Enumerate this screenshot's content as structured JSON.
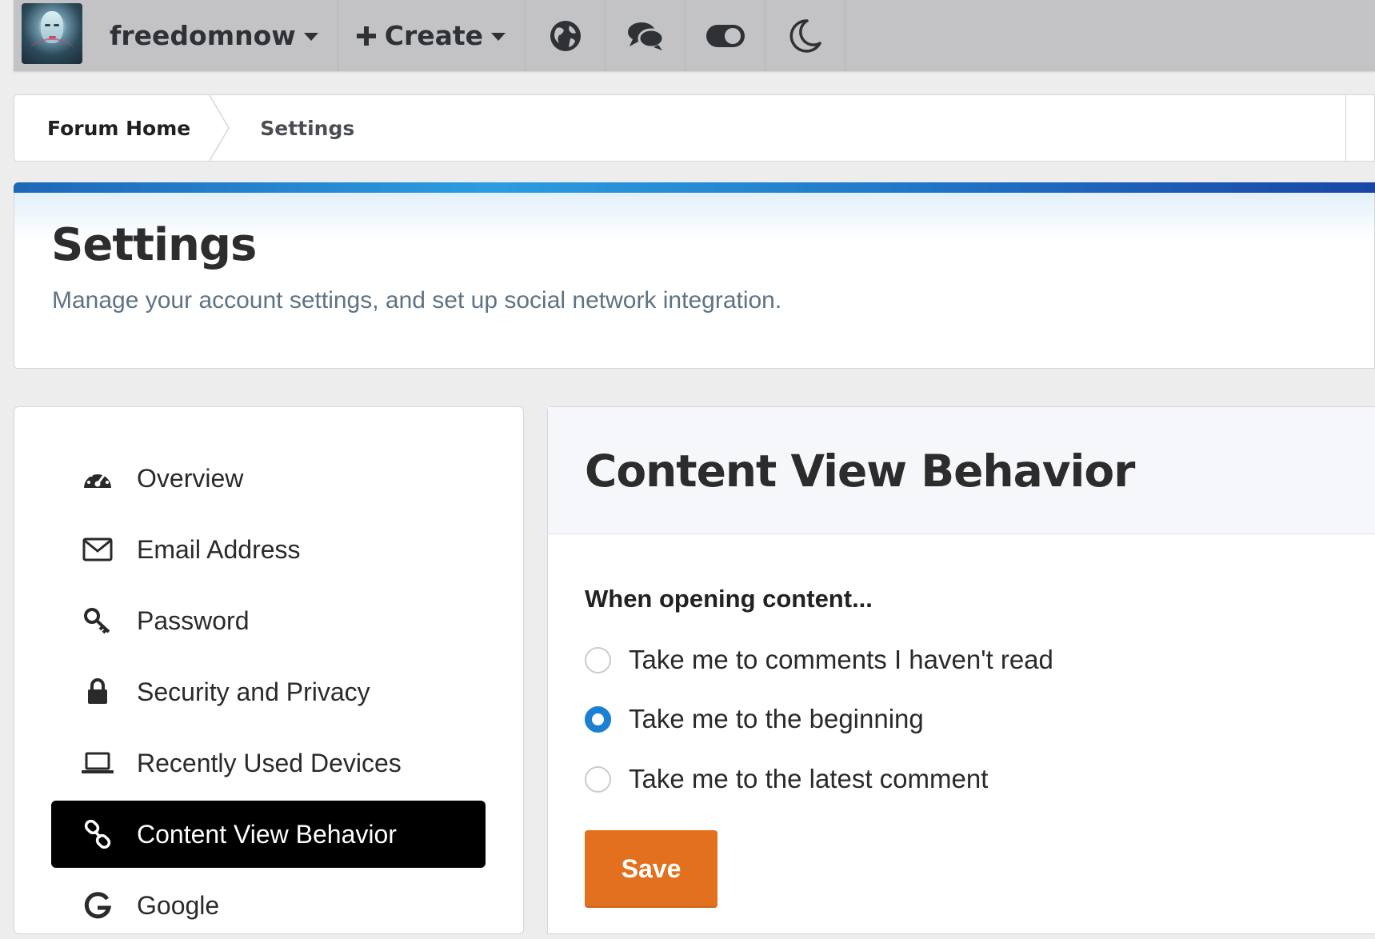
{
  "topbar": {
    "username": "freedomnow",
    "create_label": "Create",
    "icons": [
      "globe-icon",
      "chat-icon",
      "toggle-icon",
      "moon-icon"
    ]
  },
  "breadcrumb": {
    "home": "Forum Home",
    "current": "Settings"
  },
  "header": {
    "title": "Settings",
    "description": "Manage your account settings, and set up social network integration."
  },
  "sidebar": {
    "items": [
      {
        "label": "Overview",
        "icon": "dashboard-icon",
        "active": false
      },
      {
        "label": "Email Address",
        "icon": "envelope-icon",
        "active": false
      },
      {
        "label": "Password",
        "icon": "key-icon",
        "active": false
      },
      {
        "label": "Security and Privacy",
        "icon": "lock-icon",
        "active": false
      },
      {
        "label": "Recently Used Devices",
        "icon": "laptop-icon",
        "active": false
      },
      {
        "label": "Content View Behavior",
        "icon": "link-icon",
        "active": true
      },
      {
        "label": "Google",
        "icon": "google-icon",
        "active": false
      }
    ]
  },
  "main": {
    "title": "Content View Behavior",
    "legend": "When opening content...",
    "options": [
      {
        "label": "Take me to comments I haven't read",
        "selected": false
      },
      {
        "label": "Take me to the beginning",
        "selected": true
      },
      {
        "label": "Take me to the latest comment",
        "selected": false
      }
    ],
    "save_label": "Save"
  },
  "colors": {
    "accent_blue": "#1d7fd4",
    "save_orange": "#e2701f",
    "active_nav": "#000000"
  }
}
